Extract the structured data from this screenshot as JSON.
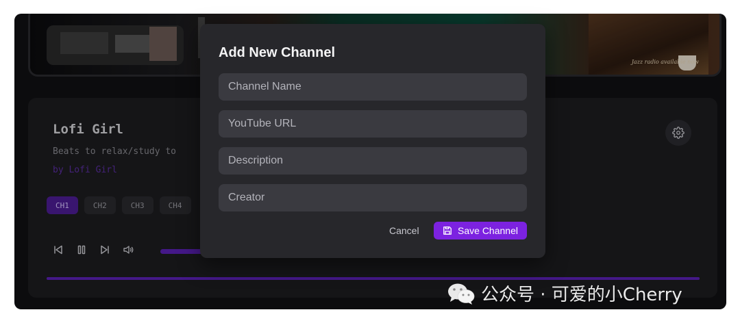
{
  "player": {
    "channel_title": "Lofi Girl",
    "channel_description": "Beats to relax/study to",
    "channel_creator": "by Lofi Girl",
    "channels": [
      "CH1",
      "CH2",
      "CH3",
      "CH4"
    ],
    "active_channel": "CH1",
    "volume_level": 1.0,
    "progress": 1.0,
    "video_overlay_text": "Jazz radio available now"
  },
  "modal": {
    "title": "Add New Channel",
    "fields": {
      "name_placeholder": "Channel Name",
      "url_placeholder": "YouTube URL",
      "description_placeholder": "Description",
      "creator_placeholder": "Creator"
    },
    "cancel_label": "Cancel",
    "save_label": "Save Channel"
  },
  "colors": {
    "accent": "#7c22e0",
    "background": "#111113",
    "modal_bg": "#27272b",
    "field_bg": "#3a3a40"
  },
  "icons": {
    "settings": "gear-icon",
    "save": "floppy-disk-icon",
    "prev": "skip-back-icon",
    "pause": "pause-icon",
    "next": "skip-forward-icon",
    "volume": "volume-icon",
    "watermark": "wechat-icon"
  },
  "watermark": {
    "text": "公众号 · 可爱的小Cherry"
  }
}
